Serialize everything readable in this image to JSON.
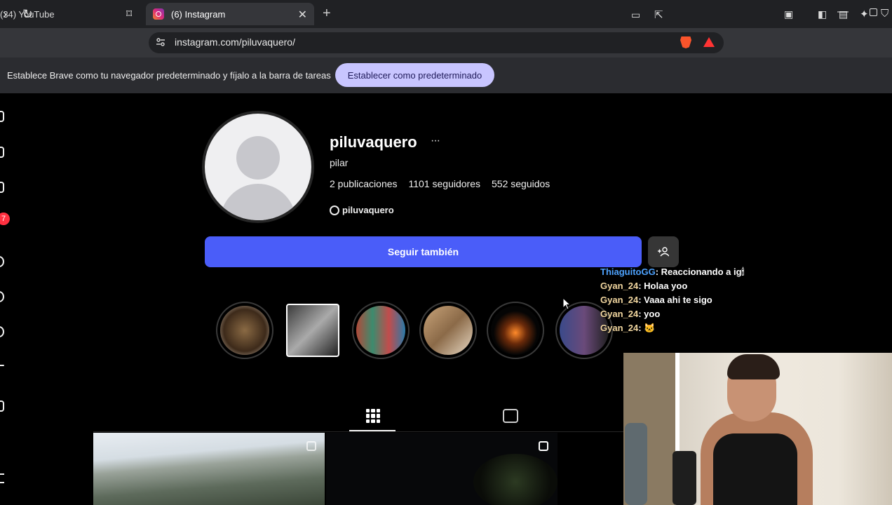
{
  "browser": {
    "tabs": [
      {
        "label": "(34) YouTube"
      },
      {
        "label": "(6) Instagram"
      }
    ],
    "url": "instagram.com/piluvaquero/",
    "infobar": {
      "text": "Establece Brave como tu navegador predeterminado y fíjalo a la barra de tareas",
      "button": "Establecer como predeterminado"
    }
  },
  "nav": {
    "notifications_badge": "7"
  },
  "profile": {
    "username": "piluvaquero",
    "more": "···",
    "full_name": "pilar",
    "stats": {
      "posts": "2 publicaciones",
      "followers": "1101 seguidores",
      "following": "552 seguidos"
    },
    "threads_handle": "piluvaquero",
    "follow_button": "Seguir también",
    "add_user_icon": "add-person-icon"
  },
  "chat": [
    {
      "name": "ThiaguitoGG",
      "text": "Reaccionando a ig🕯"
    },
    {
      "name": "Gyan_24",
      "text": "Holaa yoo"
    },
    {
      "name": "Gyan_24",
      "text": "Vaaa ahi te sigo"
    },
    {
      "name": "Gyan_24",
      "text": "yoo"
    },
    {
      "name": "Gyan_24",
      "text": "🐱"
    }
  ],
  "colors": {
    "follow_blue": "#4a5df9",
    "info_button": "#c8c5ff",
    "badge_red": "#ff3040"
  }
}
